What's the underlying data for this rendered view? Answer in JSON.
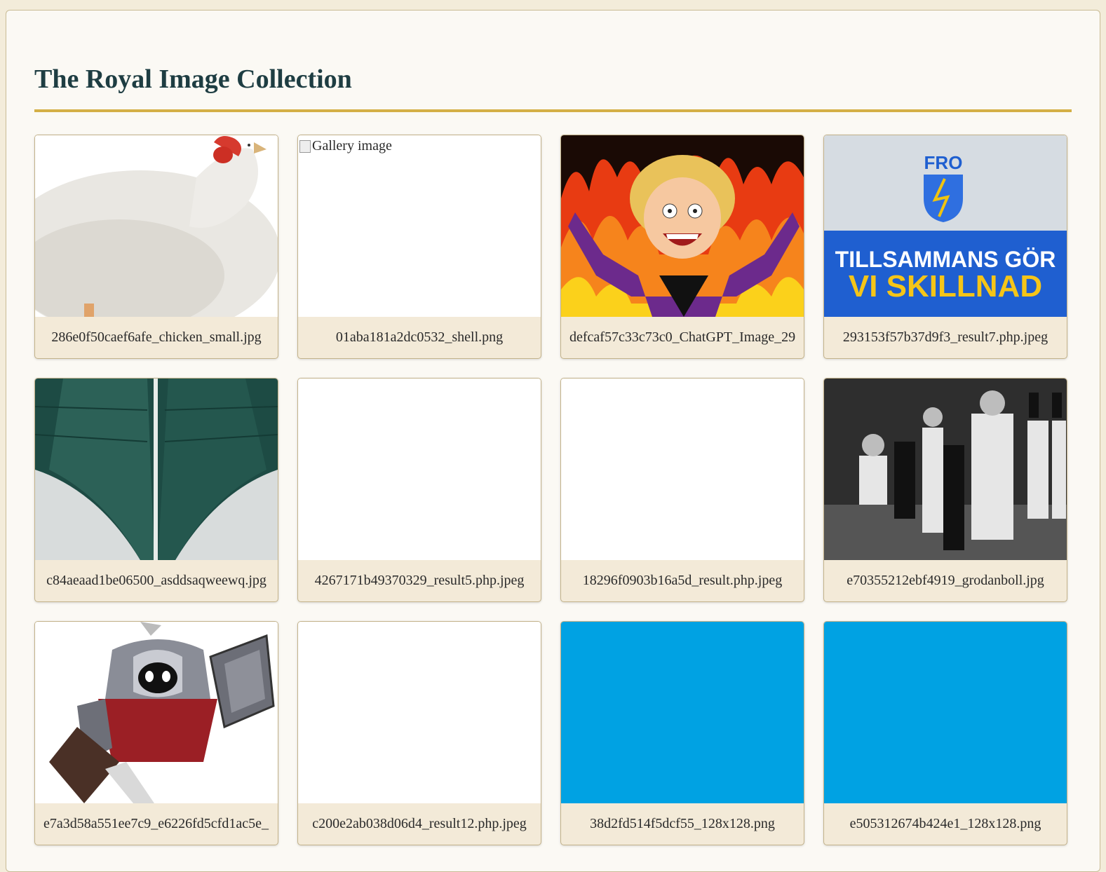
{
  "page": {
    "title": "The Royal Image Collection"
  },
  "colors": {
    "accent": "#d4af46",
    "title": "#1e3d42",
    "caption_bg": "#f3ead8",
    "cyan_tile": "#00a2e3"
  },
  "gallery": {
    "alt_text": "Gallery image",
    "items": [
      {
        "caption": "286e0f50caef6afe_chicken_small.jpg",
        "image": "chicken"
      },
      {
        "caption": "01aba181a2dc0532_shell.png",
        "image": "broken"
      },
      {
        "caption": "defcaf57c33c73c0_ChatGPT_Image_29",
        "image": "cartoon-woman-fire"
      },
      {
        "caption": "293153f57b37d9f3_result7.php.jpeg",
        "image": "fro-banner"
      },
      {
        "caption": "c84aeaad1be06500_asddsaqweewq.jpg",
        "image": "green-roof"
      },
      {
        "caption": "4267171b49370329_result5.php.jpeg",
        "image": "blank"
      },
      {
        "caption": "18296f0903b16a5d_result.php.jpeg",
        "image": "blank"
      },
      {
        "caption": "e70355212ebf4919_grodanboll.jpg",
        "image": "bw-theatre"
      },
      {
        "caption": "e7a3d58a551ee7c9_e6226fd5cfd1ac5e_",
        "image": "armored-knight"
      },
      {
        "caption": "c200e2ab038d06d4_result12.php.jpeg",
        "image": "blank"
      },
      {
        "caption": "38d2fd514f5dcf55_128x128.png",
        "image": "cyan"
      },
      {
        "caption": "e505312674b424e1_128x128.png",
        "image": "cyan"
      }
    ]
  },
  "banner": {
    "logo_text": "FRO",
    "line1": "TILLSAMMANS GÖR",
    "line2": "VI SKILLNAD"
  }
}
